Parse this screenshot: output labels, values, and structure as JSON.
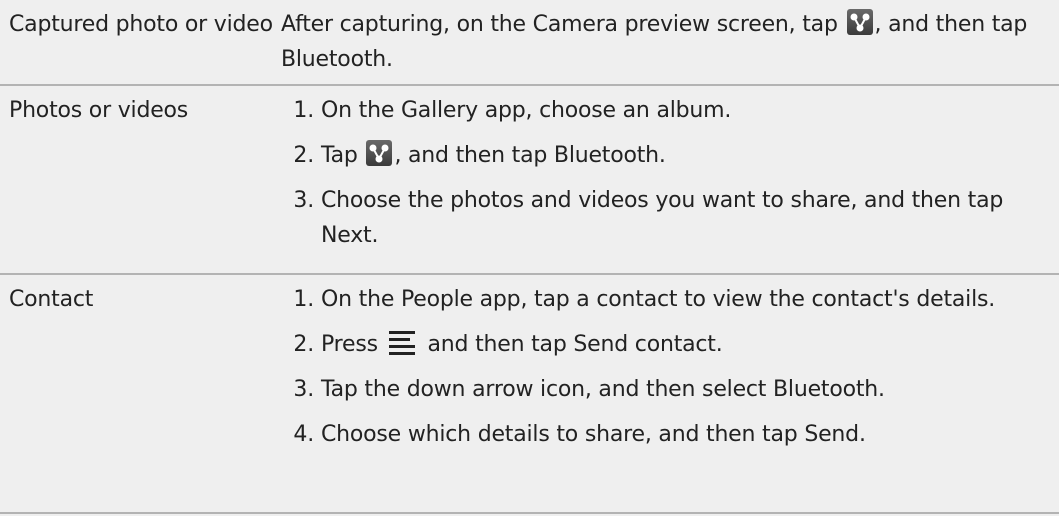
{
  "rows": [
    {
      "label": "Captured photo or video",
      "text_before_icon": "After capturing, on the Camera preview screen, tap ",
      "text_after_icon": ", and then tap ",
      "highlight": "Bluetooth",
      "end": "."
    },
    {
      "label": "Photos or videos",
      "steps": [
        {
          "num": "1.",
          "text": "On the Gallery app, choose an album."
        },
        {
          "num": "2.",
          "pre": "Tap ",
          "post": ", and then tap ",
          "highlight": "Bluetooth",
          "end": "."
        },
        {
          "num": "3.",
          "text": "Choose the photos and videos you want to share, and then tap ",
          "highlight": "Next",
          "end": "."
        }
      ]
    },
    {
      "label": "Contact",
      "steps": [
        {
          "num": "1.",
          "text": "On the People app, tap a contact to view the contact's details."
        },
        {
          "num": "2.",
          "pre": "Press ",
          "post": " and then tap ",
          "highlight": "Send contact",
          "end": "."
        },
        {
          "num": "3.",
          "text": "Tap the down arrow icon, and then select ",
          "highlight": "Bluetooth",
          "end": "."
        },
        {
          "num": "4.",
          "text": "Choose which details to share, and then tap ",
          "highlight": "Send",
          "end": "."
        }
      ]
    }
  ],
  "icons": {
    "share": "share-icon",
    "menu": "menu-icon"
  }
}
